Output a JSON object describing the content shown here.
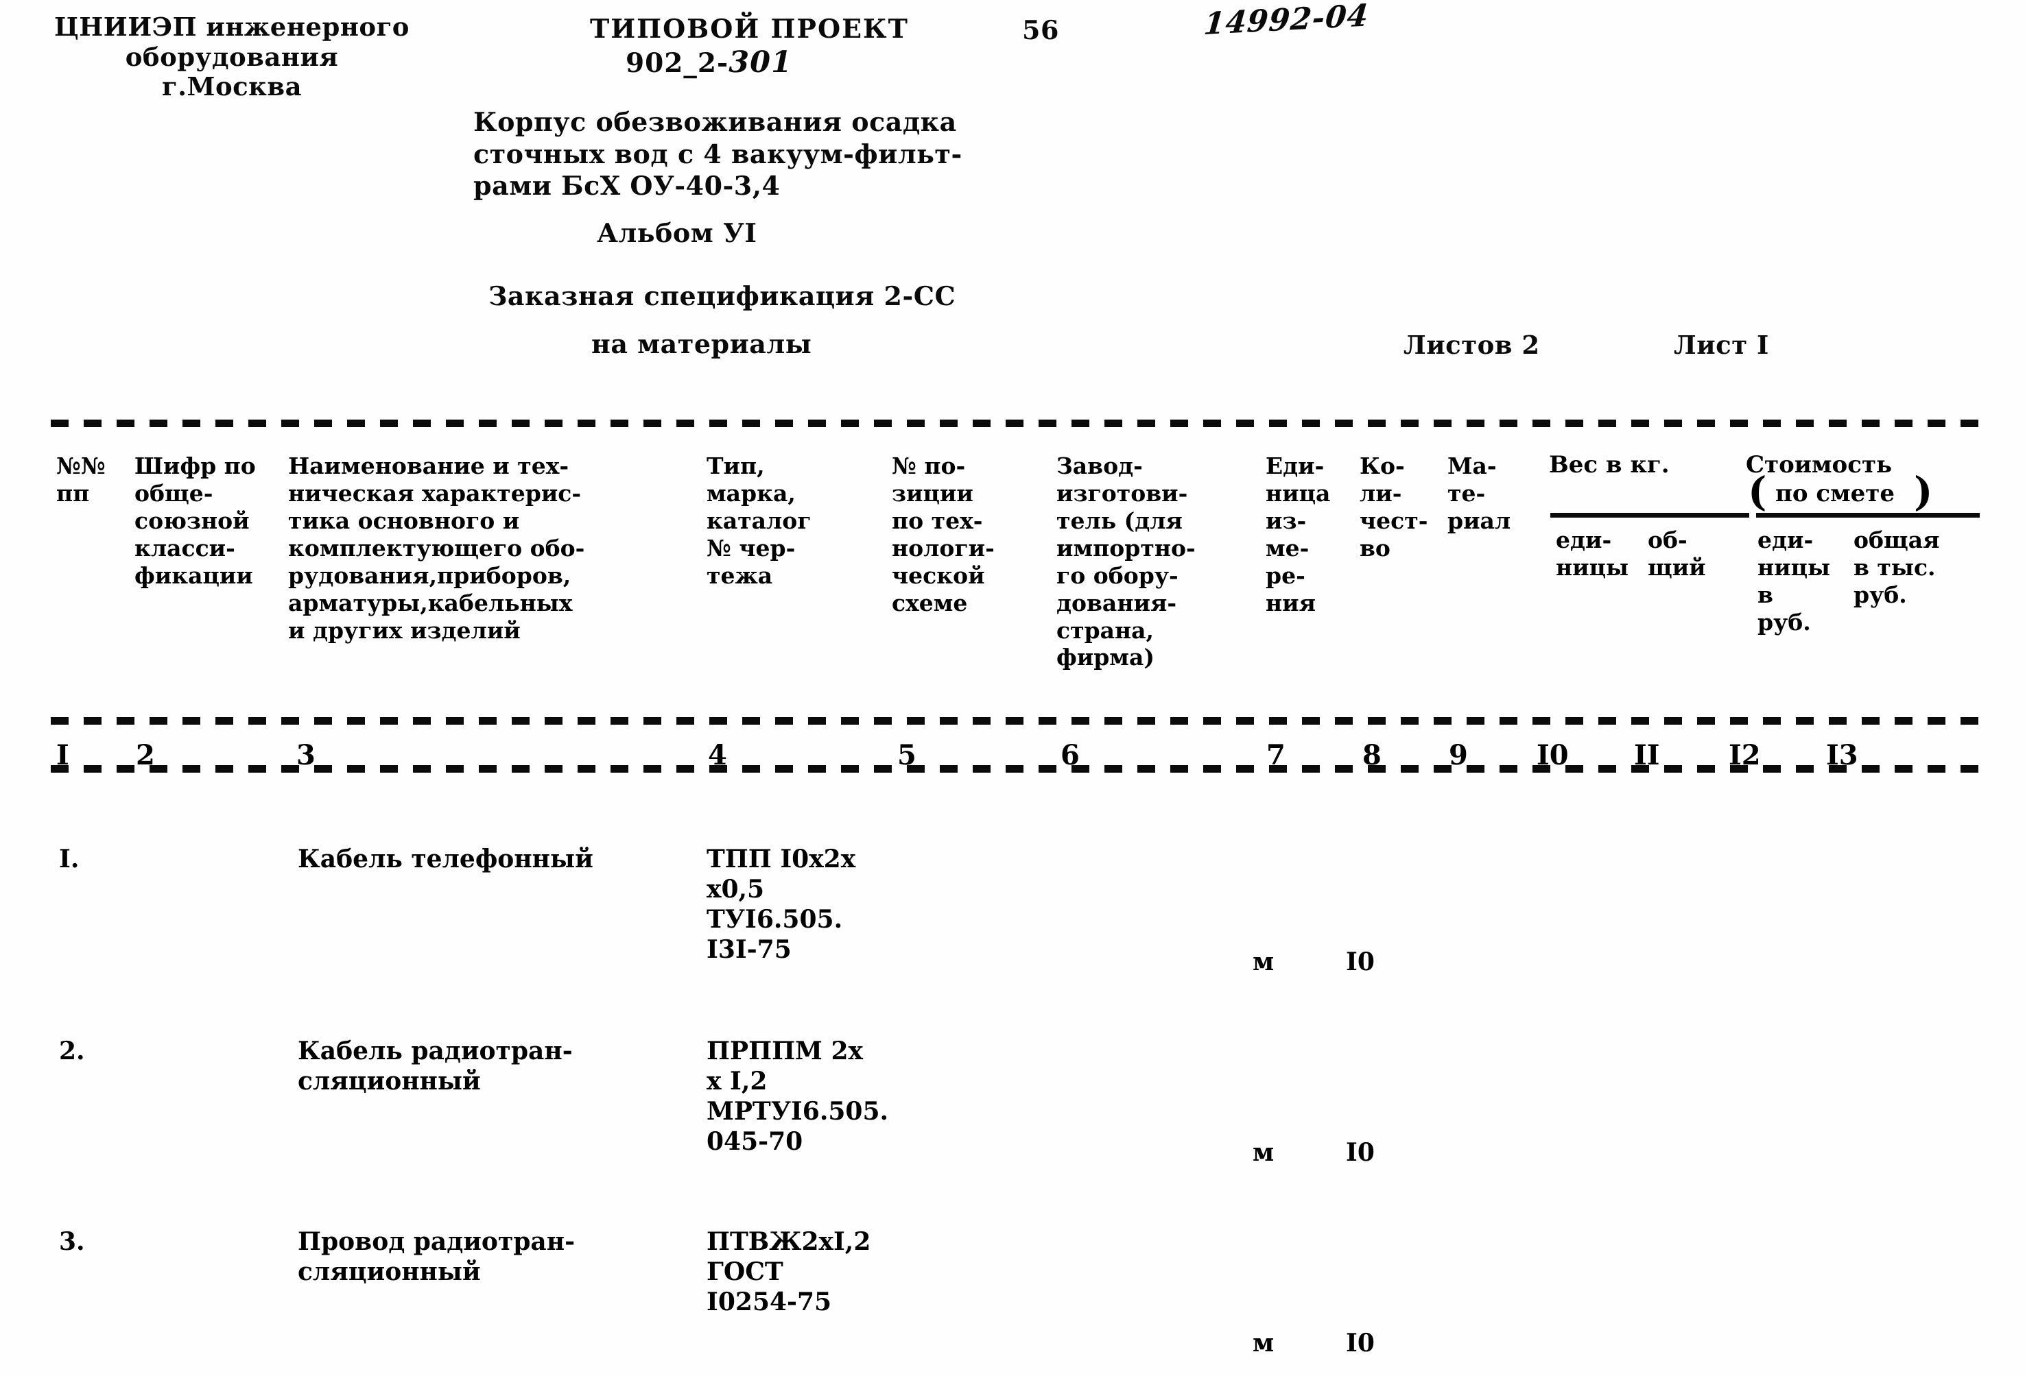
{
  "header": {
    "organization": "ЦНИИЭП инженерного\nоборудования\nг.Москва",
    "doc_kind": "ТИПОВОЙ ПРОЕКТ",
    "doc_code_prefix": "902_2-",
    "doc_code_hand": "301",
    "page_number": "56",
    "stamp_number": "14992-04",
    "object_title": "Корпус обезвоживания осадка\nсточных вод с 4 вакуум-фильт-\nрами БсХ ОУ-40-3,4",
    "album": "Альбом УI",
    "spec_title": "Заказная спецификация 2-СС",
    "spec_subtitle": "на материалы",
    "sheets_total": "Листов 2",
    "sheet_no": "Лист I"
  },
  "table": {
    "headers": {
      "col1": "№№\nпп",
      "col2": "Шифр по\nобще-\nсоюзной\nкласси-\nфикации",
      "col3": "Наименование  и  тех-\nническая характерис-\nтика основного и\nкомплектующего обо-\nрудования,приборов,\nарматуры,кабельных\nи других изделий",
      "col4": "Тип,\nмарка,\nкаталог\n№ чер-\nтежа",
      "col5": "№ по-\nзиции\nпо тех-\nнологи-\nческой\nсхеме",
      "col6": "Завод-\nизготови-\nтель (для\nимпортно-\nго обору-\nдования-\nстрана,\nфирма)",
      "col7": "Еди-\nница\nиз-\nме-\nре-\nния",
      "col8": "Ко-\nли-\nчест-\nво",
      "col9": "Ма-\nте-\nриал",
      "weight_group_title": "Вес в кг.",
      "cost_group_title": "Стоимость",
      "cost_group_subtitle": "по смете",
      "col10": "еди-\nницы",
      "col11": "об-\nщий",
      "col12": "еди-\nницы\nв\nруб.",
      "col13": "общая\nв тыс.\nруб."
    },
    "column_numbers": [
      "I",
      "2",
      "3",
      "4",
      "5",
      "6",
      "7",
      "8",
      "9",
      "I0",
      "II",
      "I2",
      "I3"
    ],
    "rows": [
      {
        "no": "I.",
        "code": "",
        "name": "Кабель телефонный",
        "type": "ТПП I0x2x\nx0,5\nТУI6.505.\nI3I-75",
        "position": "",
        "manufacturer": "",
        "unit": "м",
        "quantity": "I0",
        "material": "",
        "weight_unit": "",
        "weight_total": "",
        "cost_unit": "",
        "cost_total": ""
      },
      {
        "no": "2.",
        "code": "",
        "name": "Кабель радиотран-\nсляционный",
        "type": "ПРППМ 2х\nх I,2\nМРТУI6.505.\n045-70",
        "position": "",
        "manufacturer": "",
        "unit": "м",
        "quantity": "I0",
        "material": "",
        "weight_unit": "",
        "weight_total": "",
        "cost_unit": "",
        "cost_total": ""
      },
      {
        "no": "3.",
        "code": "",
        "name": "Провод радиотран-\nсляционный",
        "type": "ПТВЖ2хI,2\nГОСТ\nI0254-75",
        "position": "",
        "manufacturer": "",
        "unit": "м",
        "quantity": "I0",
        "material": "",
        "weight_unit": "",
        "weight_total": "",
        "cost_unit": "",
        "cost_total": ""
      }
    ]
  }
}
